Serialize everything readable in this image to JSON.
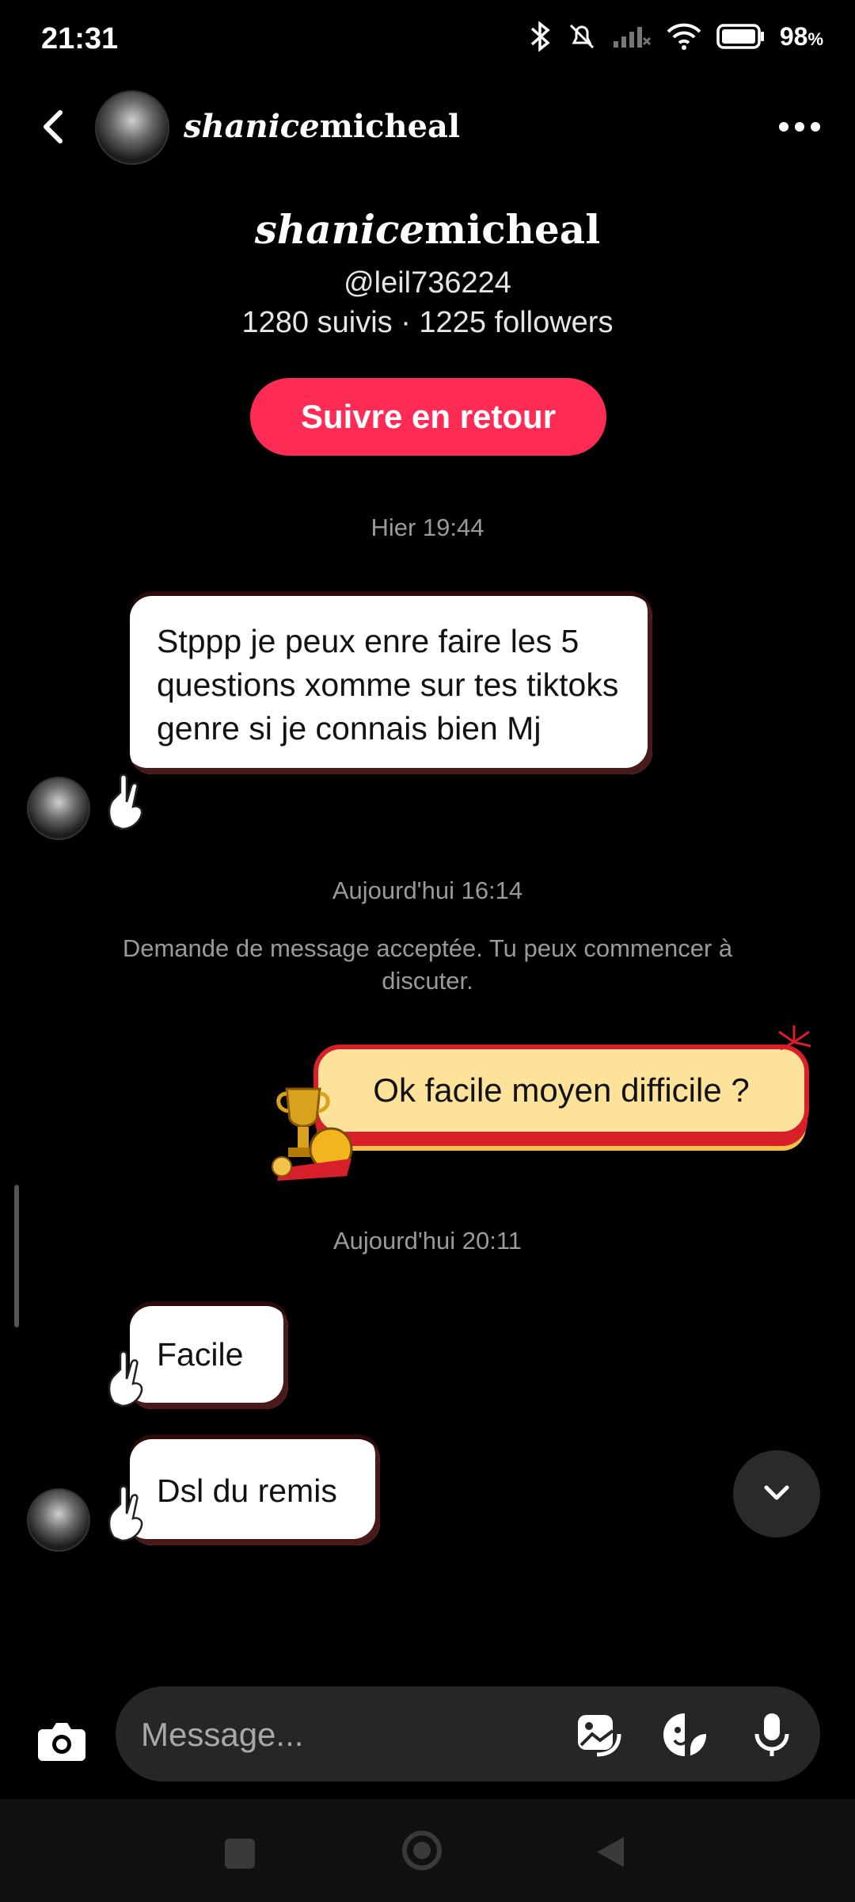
{
  "status_bar": {
    "time": "21:31",
    "battery": "98"
  },
  "header": {
    "name_italic": "shanice",
    "name_rest": "micheal"
  },
  "profile": {
    "name_italic": "shanice",
    "name_rest": "micheal",
    "handle": "@leil736224",
    "stats": "1280 suivis · 1225 followers",
    "follow_button": "Suivre en retour"
  },
  "conversation": {
    "ts1": "Hier 19:44",
    "msg1": "Stppp je peux enre faire les 5 questions xomme sur tes tiktoks genre si je connais bien Mj",
    "ts2": "Aujourd'hui 16:14",
    "system_note": "Demande de message acceptée. Tu peux commencer à discuter.",
    "msg2": "Ok facile moyen difficile ?",
    "ts3": "Aujourd'hui 20:11",
    "msg3": "Facile",
    "msg4": "Dsl du remis"
  },
  "composer": {
    "placeholder": "Message..."
  }
}
